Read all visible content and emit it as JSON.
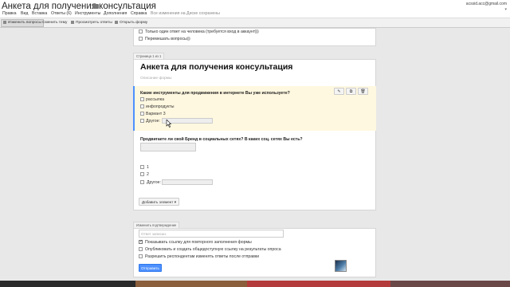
{
  "header": {
    "doc_title": "Анкета для получения консультация",
    "account": "acssid.acc@gmail.com",
    "save_status": "Все изменения на Диске сохранены"
  },
  "menu": [
    "Правка",
    "Вид",
    "Вставка",
    "Ответы (6)",
    "Инструменты",
    "Дополнения",
    "Справка"
  ],
  "toolbar": {
    "edit_questions": "Изменить вопросы",
    "change_theme": "Сменить тему",
    "view_responses": "Просмотреть ответы",
    "open_form": "Открыть форму"
  },
  "top_card": {
    "option1": "Только один ответ на человека (требуется вход в аккаунт)",
    "option2": "Перемешать вопросы"
  },
  "form": {
    "page_tab": "Страница 1 из 1",
    "title": "Анкета для получения консультация",
    "description": "Описание формы"
  },
  "q1": {
    "title": "Какие инструменты для продвижения в интернете Вы уже используете?",
    "options": [
      "рассылка",
      "инфопродукты",
      "Вариант 3",
      "Другое:"
    ],
    "actions": {
      "edit": "✎",
      "copy": "⧉",
      "delete": "🗑"
    }
  },
  "q2": {
    "title": "Продвигаете ли свой Бренд в социальных сетях? В каких соц. сетях Вы есть?",
    "options": [
      "1",
      "2",
      "Другое:"
    ],
    "add_item": "Добавить элемент"
  },
  "confirmation": {
    "tab": "Изменить подтверждение",
    "placeholder": "Ответ записан.",
    "option1": "Показывать ссылку для повторного заполнения формы",
    "option2": "Опубликовать и создать общедоступную ссылку на результаты опроса",
    "option3": "Разрешить респондентам изменять ответы после отправки",
    "submit": "Отправить"
  }
}
